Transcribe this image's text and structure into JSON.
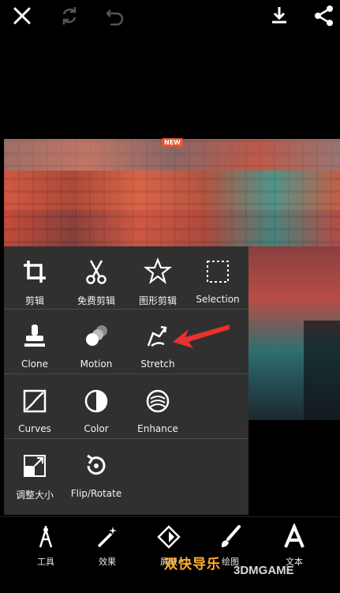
{
  "topbar": {
    "icons": [
      "close-icon",
      "redo-icon",
      "undo-icon",
      "download-icon",
      "share-icon"
    ]
  },
  "tools": {
    "row1": [
      {
        "label": "剪辑",
        "icon": "crop-icon"
      },
      {
        "label": "免费剪辑",
        "icon": "scissors-icon"
      },
      {
        "label": "图形剪辑",
        "icon": "shape-crop-icon"
      },
      {
        "label": "Selection",
        "icon": "selection-icon"
      }
    ],
    "row2": [
      {
        "label": "Clone",
        "icon": "stamp-icon"
      },
      {
        "label": "Motion",
        "icon": "motion-icon"
      },
      {
        "label": "Stretch",
        "icon": "stretch-icon"
      }
    ],
    "row3": [
      {
        "label": "Curves",
        "icon": "curves-icon"
      },
      {
        "label": "Color",
        "icon": "color-icon"
      },
      {
        "label": "Enhance",
        "icon": "enhance-icon",
        "badge": "NEW"
      }
    ],
    "row4": [
      {
        "label": "调整大小",
        "icon": "resize-icon"
      },
      {
        "label": "Flip/Rotate",
        "icon": "flip-rotate-icon"
      }
    ]
  },
  "bottombar": {
    "items": [
      {
        "label": "工具",
        "icon": "tools-icon"
      },
      {
        "label": "效果",
        "icon": "magic-wand-icon"
      },
      {
        "label": "屏蔽",
        "icon": "mask-icon"
      },
      {
        "label": "绘图",
        "icon": "brush-icon"
      },
      {
        "label": "文本",
        "icon": "text-icon"
      }
    ]
  },
  "watermark": {
    "text": "双快导乐",
    "site": "3DMGAME"
  },
  "colors": {
    "panel": "#303030",
    "accent_arrow": "#e8322f",
    "new_badge": "#e4572e"
  }
}
